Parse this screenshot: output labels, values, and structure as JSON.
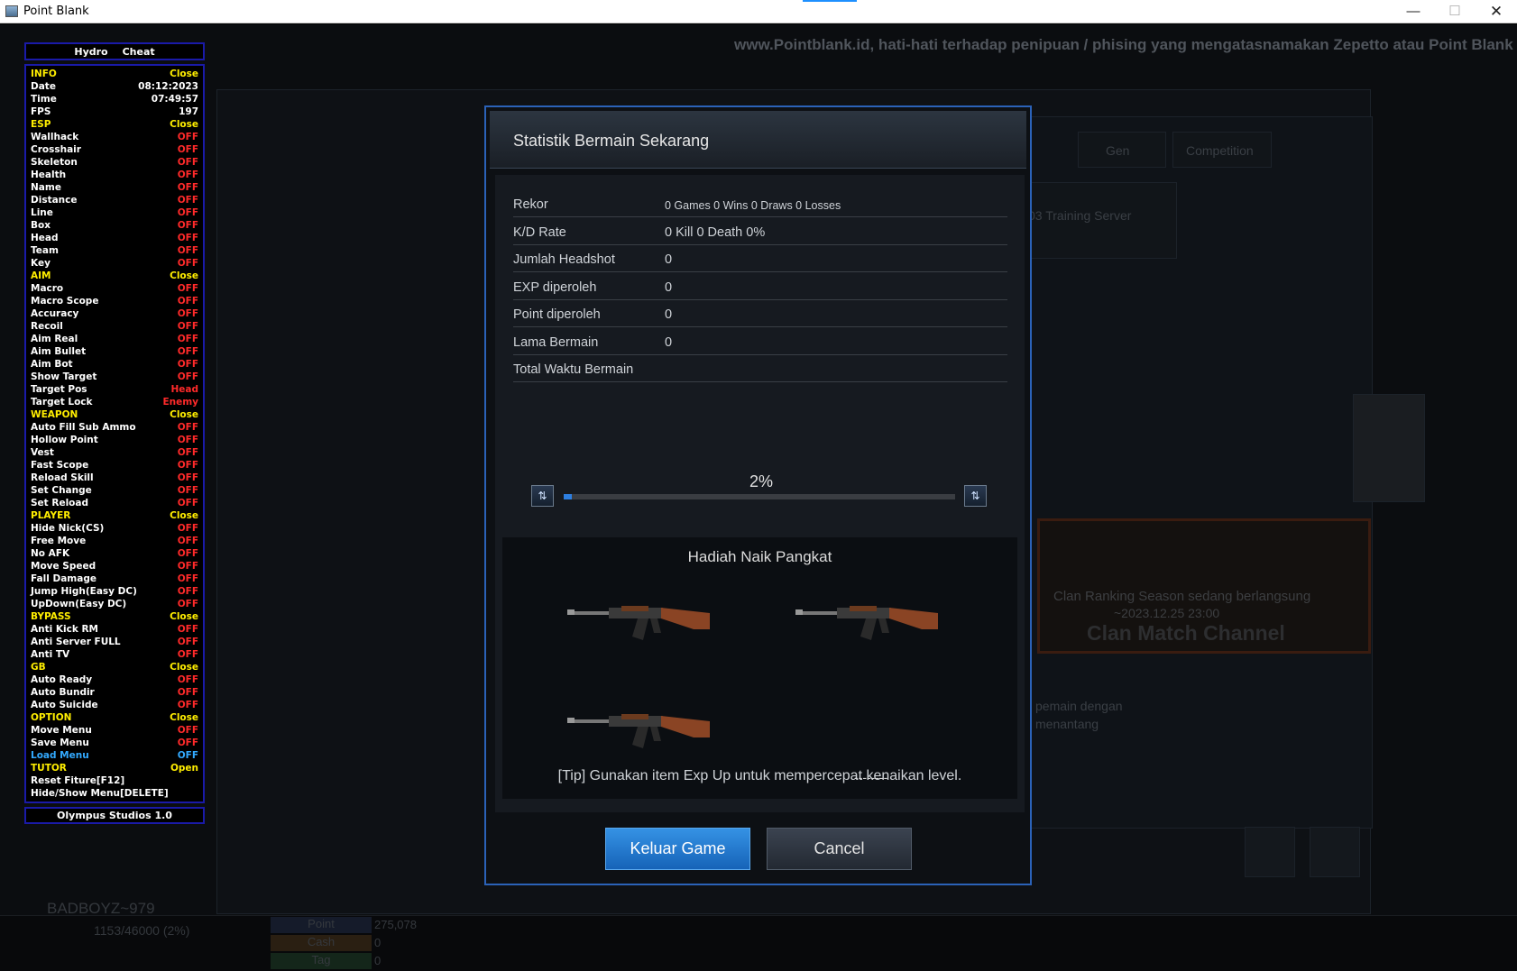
{
  "window": {
    "title": "Point Blank"
  },
  "ticker": "www.Pointblank.id, hati-hati terhadap penipuan / phising yang mengatasnamakan Zepetto atau Point Blank dengan",
  "background": {
    "tabs": [
      "Gen",
      "Competition"
    ],
    "server": "03 Training Server",
    "clan_line1": "Clan Ranking Season sedang berlangsung",
    "clan_line2": "~2023.12.25 23:00",
    "clan_line3": "Clan Match Channel",
    "text_a": "pemain dengan",
    "text_b": "menantang",
    "player_name": "BADBOYZ~979",
    "exp": "1153/46000 (2%)",
    "stats": [
      {
        "label": "Point",
        "value": "275,078"
      },
      {
        "label": "Cash",
        "value": "0"
      },
      {
        "label": "Tag",
        "value": "0"
      }
    ]
  },
  "cheat_menu": {
    "header": [
      "Hydro",
      "Cheat"
    ],
    "footer": "Olympus Studios 1.0",
    "rows": [
      {
        "label": "INFO",
        "value": "Close",
        "kind": "sec",
        "vclass": "v-close"
      },
      {
        "label": "Date",
        "value": "08:12:2023",
        "kind": "item",
        "vclass": "v-white"
      },
      {
        "label": "Time",
        "value": "07:49:57",
        "kind": "item",
        "vclass": "v-white"
      },
      {
        "label": "FPS",
        "value": "197",
        "kind": "item",
        "vclass": "v-white"
      },
      {
        "label": "ESP",
        "value": "Close",
        "kind": "sec",
        "vclass": "v-close"
      },
      {
        "label": "Wallhack",
        "value": "OFF",
        "kind": "item",
        "vclass": "v-off"
      },
      {
        "label": "Crosshair",
        "value": "OFF",
        "kind": "item",
        "vclass": "v-off"
      },
      {
        "label": "Skeleton",
        "value": "OFF",
        "kind": "item",
        "vclass": "v-off"
      },
      {
        "label": "Health",
        "value": "OFF",
        "kind": "item",
        "vclass": "v-off"
      },
      {
        "label": "Name",
        "value": "OFF",
        "kind": "item",
        "vclass": "v-off"
      },
      {
        "label": "Distance",
        "value": "OFF",
        "kind": "item",
        "vclass": "v-off"
      },
      {
        "label": "Line",
        "value": "OFF",
        "kind": "item",
        "vclass": "v-off"
      },
      {
        "label": "Box",
        "value": "OFF",
        "kind": "item",
        "vclass": "v-off"
      },
      {
        "label": "Head",
        "value": "OFF",
        "kind": "item",
        "vclass": "v-off"
      },
      {
        "label": "Team",
        "value": "OFF",
        "kind": "item",
        "vclass": "v-off"
      },
      {
        "label": "Key",
        "value": "OFF",
        "kind": "item",
        "vclass": "v-off"
      },
      {
        "label": "AIM",
        "value": "Close",
        "kind": "sec",
        "vclass": "v-close"
      },
      {
        "label": "Macro",
        "value": "OFF",
        "kind": "item",
        "vclass": "v-off"
      },
      {
        "label": "Macro Scope",
        "value": "OFF",
        "kind": "item",
        "vclass": "v-off"
      },
      {
        "label": "Accuracy",
        "value": "OFF",
        "kind": "item",
        "vclass": "v-off"
      },
      {
        "label": "Recoil",
        "value": "OFF",
        "kind": "item",
        "vclass": "v-off"
      },
      {
        "label": "Aim Real",
        "value": "OFF",
        "kind": "item",
        "vclass": "v-off"
      },
      {
        "label": "Aim Bullet",
        "value": "OFF",
        "kind": "item",
        "vclass": "v-off"
      },
      {
        "label": "Aim Bot",
        "value": "OFF",
        "kind": "item",
        "vclass": "v-off"
      },
      {
        "label": "Show Target",
        "value": "OFF",
        "kind": "item",
        "vclass": "v-off"
      },
      {
        "label": "Target Pos",
        "value": "Head",
        "kind": "item",
        "vclass": "v-off"
      },
      {
        "label": "Target Lock",
        "value": "Enemy",
        "kind": "item",
        "vclass": "v-off"
      },
      {
        "label": "WEAPON",
        "value": "Close",
        "kind": "sec",
        "vclass": "v-close"
      },
      {
        "label": "Auto Fill Sub Ammo",
        "value": "OFF",
        "kind": "item",
        "vclass": "v-off"
      },
      {
        "label": "Hollow Point",
        "value": "OFF",
        "kind": "item",
        "vclass": "v-off"
      },
      {
        "label": "Vest",
        "value": "OFF",
        "kind": "item",
        "vclass": "v-off"
      },
      {
        "label": "Fast Scope",
        "value": "OFF",
        "kind": "item",
        "vclass": "v-off"
      },
      {
        "label": "Reload Skill",
        "value": "OFF",
        "kind": "item",
        "vclass": "v-off"
      },
      {
        "label": "Set Change",
        "value": "OFF",
        "kind": "item",
        "vclass": "v-off"
      },
      {
        "label": "Set Reload",
        "value": "OFF",
        "kind": "item",
        "vclass": "v-off"
      },
      {
        "label": "PLAYER",
        "value": "Close",
        "kind": "sec",
        "vclass": "v-close"
      },
      {
        "label": "Hide Nick(CS)",
        "value": "OFF",
        "kind": "item",
        "vclass": "v-off"
      },
      {
        "label": "Free Move",
        "value": "OFF",
        "kind": "item",
        "vclass": "v-off"
      },
      {
        "label": "No AFK",
        "value": "OFF",
        "kind": "item",
        "vclass": "v-off"
      },
      {
        "label": "Move Speed",
        "value": "OFF",
        "kind": "item",
        "vclass": "v-off"
      },
      {
        "label": "Fall Damage",
        "value": "OFF",
        "kind": "item",
        "vclass": "v-off"
      },
      {
        "label": "Jump High(Easy DC)",
        "value": "OFF",
        "kind": "item",
        "vclass": "v-off"
      },
      {
        "label": "UpDown(Easy DC)",
        "value": "OFF",
        "kind": "item",
        "vclass": "v-off"
      },
      {
        "label": "BYPASS",
        "value": "Close",
        "kind": "sec",
        "vclass": "v-close"
      },
      {
        "label": "Anti Kick RM",
        "value": "OFF",
        "kind": "item",
        "vclass": "v-off"
      },
      {
        "label": "Anti Server FULL",
        "value": "OFF",
        "kind": "item",
        "vclass": "v-off"
      },
      {
        "label": "Anti TV",
        "value": "OFF",
        "kind": "item",
        "vclass": "v-off"
      },
      {
        "label": "GB",
        "value": "Close",
        "kind": "sec",
        "vclass": "v-close"
      },
      {
        "label": "Auto Ready",
        "value": "OFF",
        "kind": "item",
        "vclass": "v-off"
      },
      {
        "label": "Auto Bundir",
        "value": "OFF",
        "kind": "item",
        "vclass": "v-off"
      },
      {
        "label": "Auto Suicide",
        "value": "OFF",
        "kind": "item",
        "vclass": "v-off"
      },
      {
        "label": "OPTION",
        "value": "Close",
        "kind": "sec",
        "vclass": "v-close"
      },
      {
        "label": "Move Menu",
        "value": "OFF",
        "kind": "item",
        "vclass": "v-off"
      },
      {
        "label": "Save Menu",
        "value": "OFF",
        "kind": "item",
        "vclass": "v-off"
      },
      {
        "label": "Load Menu",
        "value": "OFF",
        "kind": "blue",
        "vclass": "v-blue"
      },
      {
        "label": "TUTOR",
        "value": "Open",
        "kind": "sec",
        "vclass": "v-close"
      },
      {
        "label": "Reset Fiture[F12]",
        "value": "",
        "kind": "item",
        "vclass": "v-white"
      },
      {
        "label": "Hide/Show Menu[DELETE]",
        "value": "",
        "kind": "item",
        "vclass": "v-white"
      }
    ]
  },
  "dialog": {
    "title": "Statistik Bermain Sekarang",
    "stats": [
      {
        "key": "Rekor",
        "value": "0 Games 0 Wins 0 Draws 0 Losses",
        "small": true
      },
      {
        "key": "K/D Rate",
        "value": "0 Kill 0 Death 0%",
        "small": false
      },
      {
        "key": "Jumlah Headshot",
        "value": "0",
        "small": false
      },
      {
        "key": "EXP diperoleh",
        "value": "0",
        "small": false
      },
      {
        "key": "Point diperoleh",
        "value": "0",
        "small": false
      },
      {
        "key": "Lama Bermain",
        "value": "0",
        "small": false
      },
      {
        "key": "Total Waktu Bermain",
        "value": "",
        "small": false
      }
    ],
    "progress_label": "2%",
    "progress_value": 0.02,
    "reward_title": "Hadiah Naik Pangkat",
    "reward_empty": "--------",
    "tip": "[Tip] Gunakan item Exp Up untuk mempercepat kenaikan level.",
    "exit_label": "Keluar Game",
    "cancel_label": "Cancel"
  },
  "colors": {
    "accent": "#2b62b8",
    "primary_button": "#1f78d1",
    "cheat_border": "#1a1aa8",
    "cheat_section": "#ffee00",
    "cheat_off": "#ff2a2a"
  }
}
